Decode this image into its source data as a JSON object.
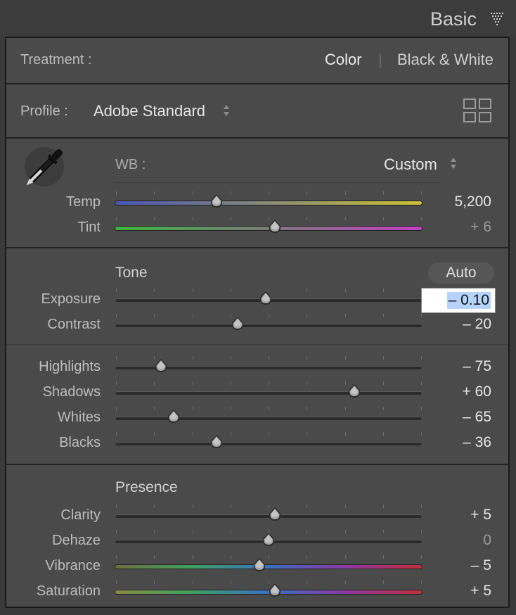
{
  "header": {
    "title": "Basic"
  },
  "treatment": {
    "label": "Treatment :",
    "color": "Color",
    "separator": "|",
    "bw": "Black & White"
  },
  "profile": {
    "label": "Profile :",
    "value": "Adobe Standard"
  },
  "wb": {
    "label": "WB :",
    "value": "Custom"
  },
  "sliders_wb": [
    {
      "label": "Temp",
      "value": "5,200",
      "position": 0.33
    },
    {
      "label": "Tint",
      "value": "+ 6",
      "position": 0.52
    }
  ],
  "tone": {
    "title": "Tone",
    "auto": "Auto"
  },
  "sliders_tone": [
    {
      "label": "Exposure",
      "value": "– 0.10",
      "position": 0.49
    },
    {
      "label": "Contrast",
      "value": "– 20",
      "position": 0.4
    },
    {
      "label": "Highlights",
      "value": "– 75",
      "position": 0.15
    },
    {
      "label": "Shadows",
      "value": "+ 60",
      "position": 0.78
    },
    {
      "label": "Whites",
      "value": "– 65",
      "position": 0.19
    },
    {
      "label": "Blacks",
      "value": "– 36",
      "position": 0.33
    }
  ],
  "presence": {
    "title": "Presence"
  },
  "sliders_presence": [
    {
      "label": "Clarity",
      "value": "+ 5",
      "position": 0.52
    },
    {
      "label": "Dehaze",
      "value": "0",
      "position": 0.5
    },
    {
      "label": "Vibrance",
      "value": "– 5",
      "position": 0.47
    },
    {
      "label": "Saturation",
      "value": "+ 5",
      "position": 0.52
    }
  ],
  "colors": {
    "temp_start": "#4a55b8",
    "temp_end": "#c9c233",
    "tint_start": "#3fb23f",
    "tint_end": "#c23fc2",
    "selection": "#b5d3fb"
  },
  "icons": [
    "dropdown-triangle-icon",
    "eyedropper-icon",
    "profile-grid-icon",
    "updown-arrows-icon",
    "slider-thumb-icon"
  ]
}
